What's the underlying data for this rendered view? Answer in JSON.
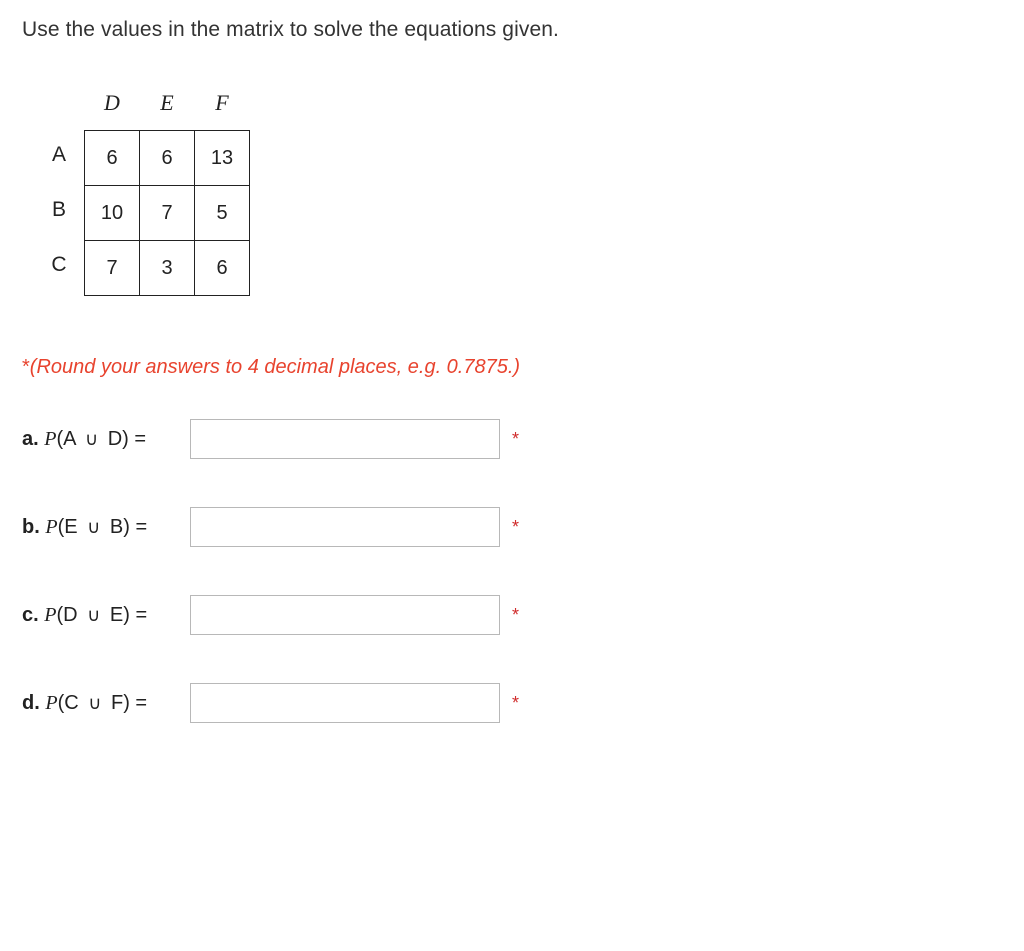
{
  "instruction": "Use the values in the matrix to solve the equations given.",
  "matrix": {
    "col_headers": [
      "D",
      "E",
      "F"
    ],
    "row_headers": [
      "A",
      "B",
      "C"
    ],
    "cells": [
      [
        "6",
        "6",
        "13"
      ],
      [
        "10",
        "7",
        "5"
      ],
      [
        "7",
        "3",
        "6"
      ]
    ]
  },
  "hint": {
    "asterisk": "*",
    "open": "(",
    "text": "Round your answers to 4 decimal places, e.g. 0.7875.",
    "close": ")"
  },
  "questions": {
    "a": {
      "letter": "a.",
      "fn": "P",
      "op": "(",
      "left": "A",
      "union": "∪",
      "right": "D",
      "eq": ") ="
    },
    "b": {
      "letter": "b.",
      "fn": "P",
      "op": "(",
      "left": "E",
      "union": "∪",
      "right": "B",
      "eq": ") ="
    },
    "c": {
      "letter": "c.",
      "fn": "P",
      "op": "(",
      "left": "D",
      "union": "∪",
      "right": "E",
      "eq": ") ="
    },
    "d": {
      "letter": "d.",
      "fn": "P",
      "op": "(",
      "left": "C",
      "union": "∪",
      "right": "F",
      "eq": ") ="
    }
  },
  "required_mark": "*",
  "chart_data": {
    "type": "table",
    "columns": [
      "D",
      "E",
      "F"
    ],
    "rows": [
      "A",
      "B",
      "C"
    ],
    "values": [
      [
        6,
        6,
        13
      ],
      [
        10,
        7,
        5
      ],
      [
        7,
        3,
        6
      ]
    ]
  }
}
